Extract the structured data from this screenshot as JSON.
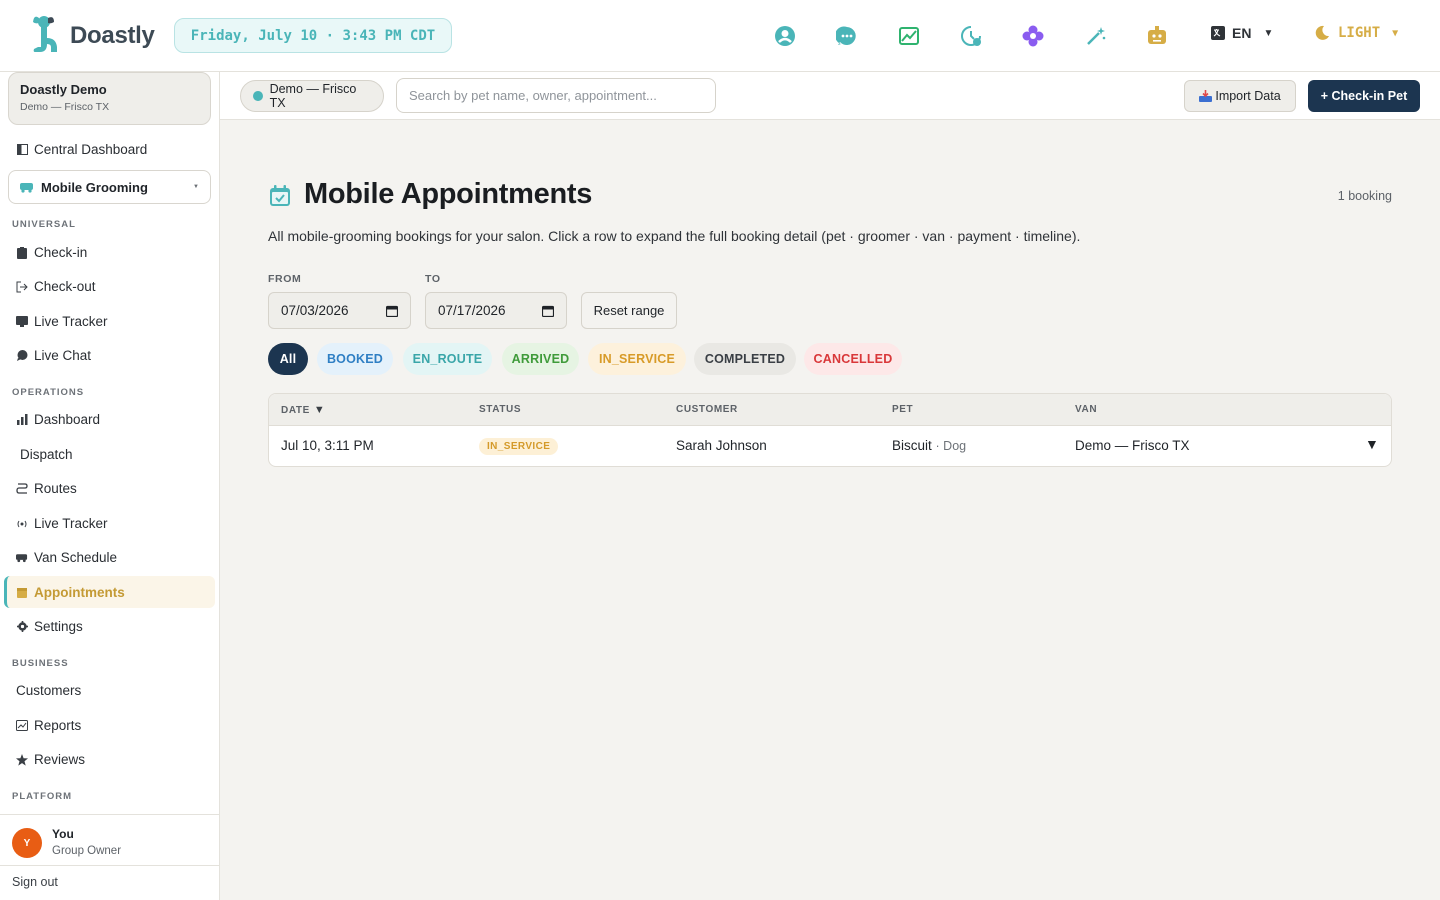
{
  "brand": {
    "name": "Doastly"
  },
  "clock": "Friday, July 10 · 3:43 PM CDT",
  "top_icons": [
    "user-circle-icon",
    "chat-bubble-icon",
    "image-chart-icon",
    "history-clock-icon",
    "flower-icon",
    "magic-wand-icon",
    "robot-icon"
  ],
  "language": {
    "icon": "translate-icon",
    "label": "EN"
  },
  "theme": {
    "icon": "moon-icon",
    "label": "LIGHT"
  },
  "tenant": {
    "name": "Doastly Demo",
    "location": "Demo — Frisco TX"
  },
  "sidebar": {
    "central_dashboard": "Central Dashboard",
    "module": "Mobile Grooming",
    "sections": {
      "universal": "UNIVERSAL",
      "operations": "OPERATIONS",
      "business": "BUSINESS",
      "platform": "PLATFORM"
    },
    "universal": [
      "Check-in",
      "Check-out",
      "Live Tracker",
      "Live Chat"
    ],
    "operations": [
      "Dashboard",
      "Dispatch",
      "Routes",
      "Live Tracker",
      "Van Schedule",
      "Appointments",
      "Settings"
    ],
    "business": [
      "Customers",
      "Reports",
      "Reviews"
    ],
    "active_item": "Appointments"
  },
  "user": {
    "initial": "Y",
    "name": "You",
    "role": "Group Owner"
  },
  "sign_out": "Sign out",
  "subbar": {
    "location": "Demo — Frisco TX",
    "search_placeholder": "Search by pet name, owner, appointment...",
    "import_label": "Import Data",
    "checkin_label": "+ Check-in Pet"
  },
  "page": {
    "title": "Mobile Appointments",
    "count": "1 booking",
    "description": "All mobile-grooming bookings for your salon. Click a row to expand the full booking detail (pet · groomer · van · payment · timeline)."
  },
  "range": {
    "from_label": "FROM",
    "from_value": "07/03/2026",
    "to_label": "TO",
    "to_value": "07/17/2026",
    "reset_label": "Reset range"
  },
  "filters": [
    {
      "label": "All",
      "bg": "#1c3550",
      "fg": "#ffffff"
    },
    {
      "label": "BOOKED",
      "bg": "#e4f1fb",
      "fg": "#2f7fc4"
    },
    {
      "label": "EN_ROUTE",
      "bg": "#e3f5f5",
      "fg": "#3aa6a9"
    },
    {
      "label": "ARRIVED",
      "bg": "#e6f4e3",
      "fg": "#3f9b3a"
    },
    {
      "label": "IN_SERVICE",
      "bg": "#fdf1dc",
      "fg": "#d89b28"
    },
    {
      "label": "COMPLETED",
      "bg": "#e9e8e4",
      "fg": "#3a3f45"
    },
    {
      "label": "CANCELLED",
      "bg": "#fde8e8",
      "fg": "#d9383a"
    }
  ],
  "table": {
    "columns": [
      "DATE",
      "STATUS",
      "CUSTOMER",
      "PET",
      "VAN"
    ],
    "sort_indicator": "▼",
    "rows": [
      {
        "date": "Jul 10, 3:11 PM",
        "status": "IN_SERVICE",
        "customer": "Sarah Johnson",
        "pet": "Biscuit",
        "species": "· Dog",
        "van": "Demo — Frisco TX",
        "expand": "▼"
      }
    ]
  },
  "colors": {
    "accent_teal": "#4ab5b8",
    "navy": "#1c3550",
    "gold": "#d6ad46"
  }
}
